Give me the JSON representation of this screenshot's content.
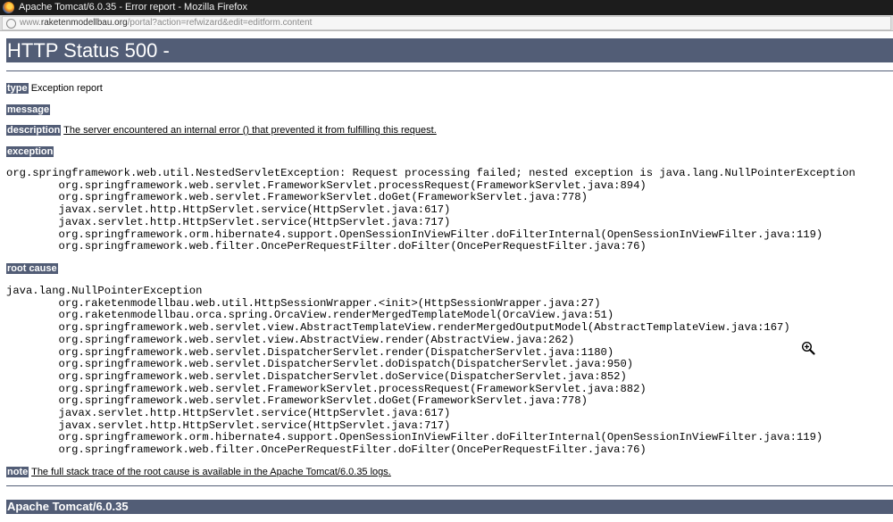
{
  "window": {
    "title": "Apache Tomcat/6.0.35 - Error report - Mozilla Firefox",
    "url_prefix": "www.",
    "url_domain": "raketenmodellbau.org",
    "url_path": "/portal?action=refwizard&edit=editform.content"
  },
  "page": {
    "heading": "HTTP Status 500 -",
    "type_label": "type",
    "type_value": "Exception report",
    "message_label": "message",
    "description_label": "description",
    "description_value": "The server encountered an internal error () that prevented it from fulfilling this request.",
    "exception_label": "exception",
    "exception_trace": "org.springframework.web.util.NestedServletException: Request processing failed; nested exception is java.lang.NullPointerException\n\torg.springframework.web.servlet.FrameworkServlet.processRequest(FrameworkServlet.java:894)\n\torg.springframework.web.servlet.FrameworkServlet.doGet(FrameworkServlet.java:778)\n\tjavax.servlet.http.HttpServlet.service(HttpServlet.java:617)\n\tjavax.servlet.http.HttpServlet.service(HttpServlet.java:717)\n\torg.springframework.orm.hibernate4.support.OpenSessionInViewFilter.doFilterInternal(OpenSessionInViewFilter.java:119)\n\torg.springframework.web.filter.OncePerRequestFilter.doFilter(OncePerRequestFilter.java:76)",
    "root_cause_label": "root cause",
    "root_cause_trace": "java.lang.NullPointerException\n\torg.raketenmodellbau.web.util.HttpSessionWrapper.<init>(HttpSessionWrapper.java:27)\n\torg.raketenmodellbau.orca.spring.OrcaView.renderMergedTemplateModel(OrcaView.java:51)\n\torg.springframework.web.servlet.view.AbstractTemplateView.renderMergedOutputModel(AbstractTemplateView.java:167)\n\torg.springframework.web.servlet.view.AbstractView.render(AbstractView.java:262)\n\torg.springframework.web.servlet.DispatcherServlet.render(DispatcherServlet.java:1180)\n\torg.springframework.web.servlet.DispatcherServlet.doDispatch(DispatcherServlet.java:950)\n\torg.springframework.web.servlet.DispatcherServlet.doService(DispatcherServlet.java:852)\n\torg.springframework.web.servlet.FrameworkServlet.processRequest(FrameworkServlet.java:882)\n\torg.springframework.web.servlet.FrameworkServlet.doGet(FrameworkServlet.java:778)\n\tjavax.servlet.http.HttpServlet.service(HttpServlet.java:617)\n\tjavax.servlet.http.HttpServlet.service(HttpServlet.java:717)\n\torg.springframework.orm.hibernate4.support.OpenSessionInViewFilter.doFilterInternal(OpenSessionInViewFilter.java:119)\n\torg.springframework.web.filter.OncePerRequestFilter.doFilter(OncePerRequestFilter.java:76)",
    "note_label": "note",
    "note_value": "The full stack trace of the root cause is available in the Apache Tomcat/6.0.35 logs.",
    "footer": "Apache Tomcat/6.0.35"
  },
  "colors": {
    "header_bg": "#525d76",
    "header_text": "#ffffff",
    "titlebar_bg": "#1c1c1c"
  },
  "icons": {
    "browser": "firefox-icon",
    "site": "globe-icon",
    "cursor": "zoom-in-cursor-icon"
  }
}
